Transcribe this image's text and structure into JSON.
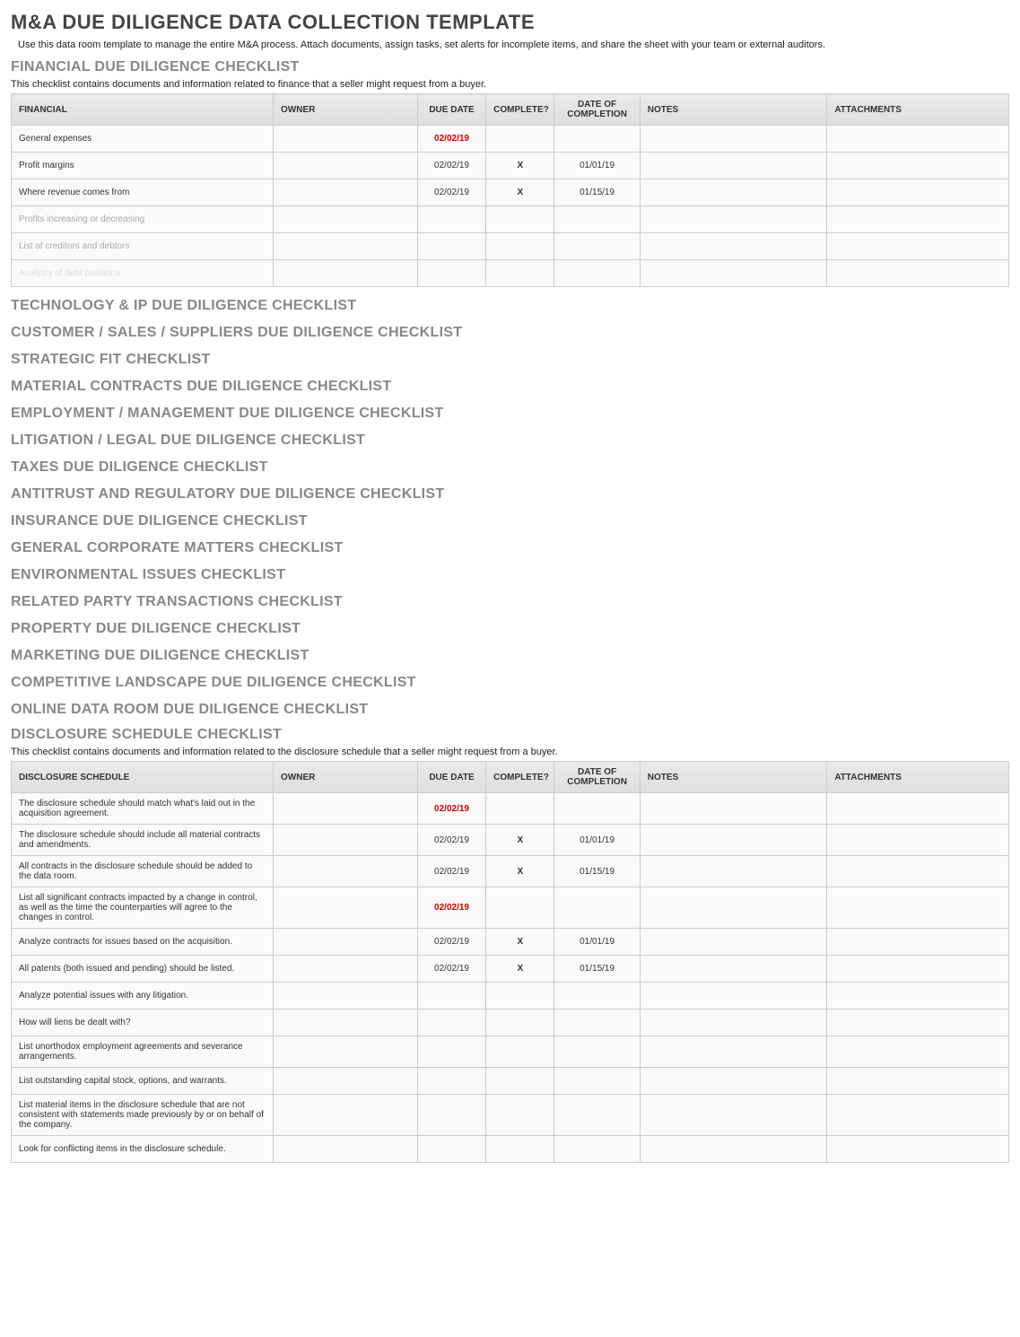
{
  "header": {
    "title": "M&A DUE DILIGENCE DATA COLLECTION TEMPLATE",
    "intro": "Use this data room template to manage the entire M&A process. Attach documents, assign tasks, set alerts for incomplete items, and share the sheet with your team or external auditors."
  },
  "columns": {
    "owner": "OWNER",
    "due_date": "DUE DATE",
    "complete": "COMPLETE?",
    "date_of_completion": "DATE OF COMPLETION",
    "notes": "NOTES",
    "attachments": "ATTACHMENTS"
  },
  "financial": {
    "title": "FINANCIAL DUE DILIGENCE CHECKLIST",
    "desc": "This checklist contains documents and information related to finance that a seller might request from a buyer.",
    "col_header": "FINANCIAL",
    "rows": [
      {
        "item": "General expenses",
        "owner": "",
        "due": "02/02/19",
        "due_red": true,
        "complete": "",
        "doc": "",
        "notes": "",
        "att": "",
        "dim": ""
      },
      {
        "item": "Profit margins",
        "owner": "",
        "due": "02/02/19",
        "due_red": false,
        "complete": "X",
        "doc": "01/01/19",
        "notes": "",
        "att": "",
        "dim": ""
      },
      {
        "item": "Where revenue comes from",
        "owner": "",
        "due": "02/02/19",
        "due_red": false,
        "complete": "X",
        "doc": "01/15/19",
        "notes": "",
        "att": "",
        "dim": ""
      },
      {
        "item": "Profits increasing or decreasing",
        "owner": "",
        "due": "",
        "due_red": false,
        "complete": "",
        "doc": "",
        "notes": "",
        "att": "",
        "dim": "dim"
      },
      {
        "item": "List of creditors and debtors",
        "owner": "",
        "due": "",
        "due_red": false,
        "complete": "",
        "doc": "",
        "notes": "",
        "att": "",
        "dim": "dim"
      },
      {
        "item": "Analysis of debt positions",
        "owner": "",
        "due": "",
        "due_red": false,
        "complete": "",
        "doc": "",
        "notes": "",
        "att": "",
        "dim": "dim2"
      }
    ]
  },
  "sections": [
    "TECHNOLOGY & IP DUE DILIGENCE CHECKLIST",
    "CUSTOMER / SALES / SUPPLIERS DUE DILIGENCE CHECKLIST",
    "STRATEGIC FIT CHECKLIST",
    "MATERIAL CONTRACTS DUE DILIGENCE CHECKLIST",
    "EMPLOYMENT / MANAGEMENT DUE DILIGENCE CHECKLIST",
    "LITIGATION / LEGAL DUE DILIGENCE CHECKLIST",
    "TAXES DUE DILIGENCE CHECKLIST",
    "ANTITRUST AND REGULATORY DUE DILIGENCE CHECKLIST",
    "INSURANCE DUE DILIGENCE CHECKLIST",
    "GENERAL CORPORATE MATTERS CHECKLIST",
    "ENVIRONMENTAL ISSUES CHECKLIST",
    "RELATED PARTY TRANSACTIONS CHECKLIST",
    "PROPERTY DUE DILIGENCE CHECKLIST",
    "MARKETING DUE DILIGENCE CHECKLIST",
    "COMPETITIVE LANDSCAPE DUE DILIGENCE CHECKLIST",
    "ONLINE DATA ROOM DUE DILIGENCE CHECKLIST"
  ],
  "disclosure": {
    "title": "DISCLOSURE SCHEDULE CHECKLIST",
    "desc": "This checklist contains documents and information related to the disclosure schedule that a seller might request from a buyer.",
    "col_header": "DISCLOSURE SCHEDULE",
    "rows": [
      {
        "item": "The disclosure schedule should match what's laid out in the acquisition agreement.",
        "owner": "",
        "due": "02/02/19",
        "due_red": true,
        "complete": "",
        "doc": "",
        "notes": "",
        "att": ""
      },
      {
        "item": "The disclosure schedule should include all material contracts and amendments.",
        "owner": "",
        "due": "02/02/19",
        "due_red": false,
        "complete": "X",
        "doc": "01/01/19",
        "notes": "",
        "att": ""
      },
      {
        "item": "All contracts in the disclosure schedule should be added to the data room.",
        "owner": "",
        "due": "02/02/19",
        "due_red": false,
        "complete": "X",
        "doc": "01/15/19",
        "notes": "",
        "att": ""
      },
      {
        "item": "List all significant contracts impacted by a change in control, as well as the time the counterparties will agree to the changes in control.",
        "owner": "",
        "due": "02/02/19",
        "due_red": true,
        "complete": "",
        "doc": "",
        "notes": "",
        "att": ""
      },
      {
        "item": "Analyze contracts for issues based on the acquisition.",
        "owner": "",
        "due": "02/02/19",
        "due_red": false,
        "complete": "X",
        "doc": "01/01/19",
        "notes": "",
        "att": ""
      },
      {
        "item": "All patents (both issued and pending) should be listed.",
        "owner": "",
        "due": "02/02/19",
        "due_red": false,
        "complete": "X",
        "doc": "01/15/19",
        "notes": "",
        "att": ""
      },
      {
        "item": "Analyze potential issues with any litigation.",
        "owner": "",
        "due": "",
        "due_red": false,
        "complete": "",
        "doc": "",
        "notes": "",
        "att": ""
      },
      {
        "item": "How will liens be dealt with?",
        "owner": "",
        "due": "",
        "due_red": false,
        "complete": "",
        "doc": "",
        "notes": "",
        "att": ""
      },
      {
        "item": "List unorthodox employment agreements and severance arrangements.",
        "owner": "",
        "due": "",
        "due_red": false,
        "complete": "",
        "doc": "",
        "notes": "",
        "att": ""
      },
      {
        "item": "List outstanding capital stock, options, and warrants.",
        "owner": "",
        "due": "",
        "due_red": false,
        "complete": "",
        "doc": "",
        "notes": "",
        "att": ""
      },
      {
        "item": "List material items in the disclosure schedule that are not consistent with statements made previously by or on behalf of the company.",
        "owner": "",
        "due": "",
        "due_red": false,
        "complete": "",
        "doc": "",
        "notes": "",
        "att": ""
      },
      {
        "item": "Look for conflicting items in the disclosure schedule.",
        "owner": "",
        "due": "",
        "due_red": false,
        "complete": "",
        "doc": "",
        "notes": "",
        "att": ""
      }
    ]
  }
}
